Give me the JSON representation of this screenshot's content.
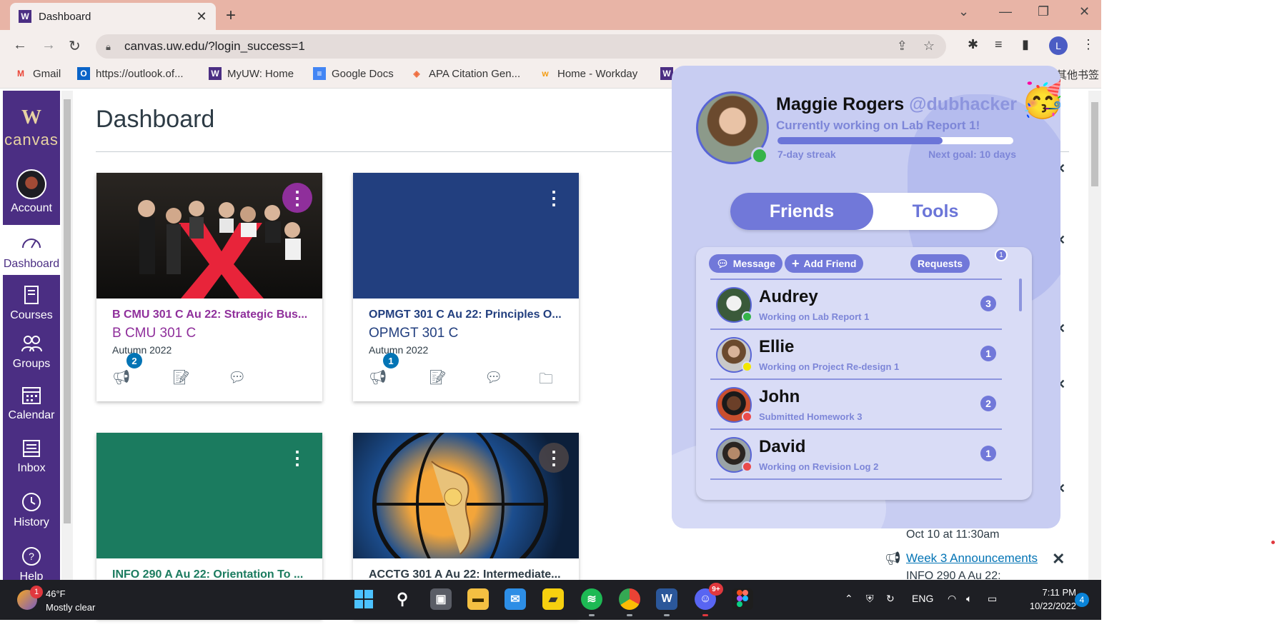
{
  "browser": {
    "tab_title": "Dashboard",
    "url": "canvas.uw.edu/?login_success=1",
    "bookmarks": [
      "Gmail",
      "https://outlook.of...",
      "MyUW: Home",
      "Google Docs",
      "APA Citation Gen...",
      "Home - Workday"
    ],
    "other_bookmarks": "其他书签",
    "profile_initial": "L"
  },
  "nav": {
    "logo_w": "W",
    "logo_text": "canvas",
    "items": [
      "Account",
      "Dashboard",
      "Courses",
      "Groups",
      "Calendar",
      "Inbox",
      "History",
      "Help"
    ]
  },
  "dashboard": {
    "title": "Dashboard",
    "cards": [
      {
        "name": "B CMU 301 C Au 22: Strategic Bus...",
        "code": "B CMU 301 C",
        "term": "Autumn 2022",
        "badge": "2",
        "color": "#8f2f9b"
      },
      {
        "name": "OPMGT 301 C Au 22: Principles O...",
        "code": "OPMGT 301 C",
        "term": "Autumn 2022",
        "badge": "1",
        "color": "#223f7f"
      },
      {
        "name": "INFO 290 A Au 22: Orientation To ...",
        "color": "#1b7b5f"
      },
      {
        "name": "ACCTG 301 A Au 22: Intermediate...",
        "color": "#2d3b45"
      }
    ]
  },
  "todo": {
    "date": "Oct 10 at 11:30am",
    "link": "Week 3 Announcements",
    "sub": "INFO 290 A Au 22:"
  },
  "overlay": {
    "name": "Maggie Rogers",
    "handle": "@dubhacker",
    "status": "Currently working on Lab Report 1!",
    "streak_label": "7-day streak",
    "next_goal": "Next goal: 10 days",
    "streak_progress": 0.7,
    "tabs": {
      "friends": "Friends",
      "tools": "Tools"
    },
    "actions": {
      "message": "Message",
      "add_friend": "Add Friend",
      "requests": "Requests",
      "requests_count": "1"
    },
    "friends": [
      {
        "name": "Audrey",
        "activity": "Working on Lab Report 1",
        "count": "3",
        "status_color": "#35b34a"
      },
      {
        "name": "Ellie",
        "activity": "Working on Project Re-design 1",
        "count": "1",
        "status_color": "#f2e600"
      },
      {
        "name": "John",
        "activity": "Submitted Homework 3",
        "count": "2",
        "status_color": "#ea4b4b"
      },
      {
        "name": "David",
        "activity": "Working on Revision Log 2",
        "count": "1",
        "status_color": "#ea4b4b"
      }
    ]
  },
  "taskbar": {
    "weather_badge": "1",
    "temp": "46°F",
    "weather": "Mostly clear",
    "language": "ENG",
    "time": "7:11 PM",
    "date": "10/22/2022",
    "notifications": "4",
    "discord_badge": "9+"
  }
}
